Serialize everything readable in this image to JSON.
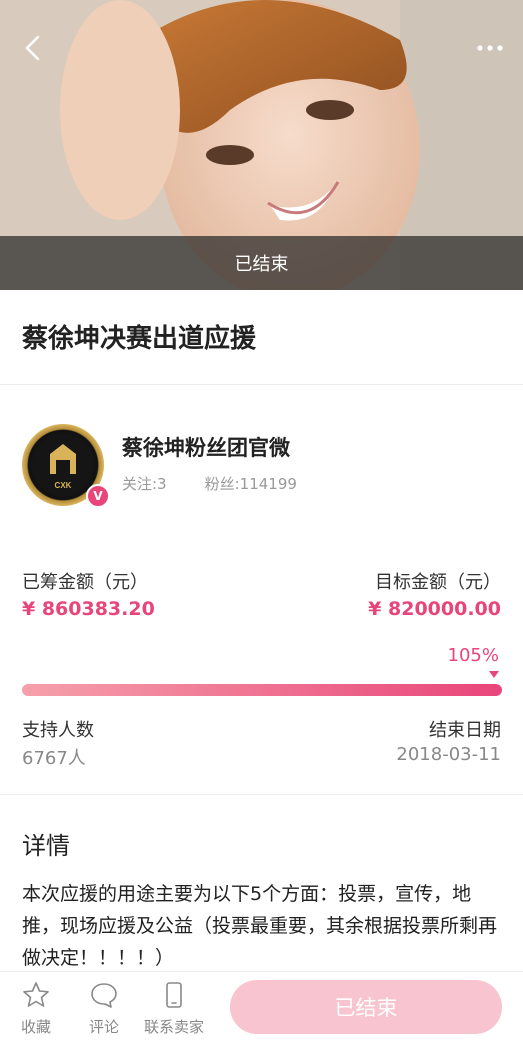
{
  "hero": {
    "status_label": "已结束"
  },
  "project": {
    "title": "蔡徐坤决赛出道应援"
  },
  "organizer": {
    "name": "蔡徐坤粉丝团官微",
    "follow_label": "关注:3",
    "fans_label": "粉丝:114199",
    "verified_badge": "V",
    "logo_text": "KUN'S FAN CLUB"
  },
  "funding": {
    "raised_label": "已筹金额（元）",
    "raised_value": "¥ 860383.20",
    "target_label": "目标金额（元）",
    "target_value": "¥ 820000.00",
    "percent_label": "105%",
    "progress_fraction": 1.0
  },
  "stats": {
    "supporters_label": "支持人数",
    "supporters_value": "6767人",
    "end_date_label": "结束日期",
    "end_date_value": "2018-03-11"
  },
  "detail": {
    "heading": "详情",
    "body": "本次应援的用途主要为以下5个方面：投票，宣传，地推，现场应援及公益（投票最重要，其余根据投票所剩再做决定！！！！）"
  },
  "tabbar": {
    "items": [
      {
        "label": "收藏",
        "icon": "star-icon"
      },
      {
        "label": "评论",
        "icon": "chat-bubble-icon"
      },
      {
        "label": "联系卖家",
        "icon": "phone-icon"
      }
    ],
    "action_label": "已结束"
  },
  "colors": {
    "accent": "#e8457a",
    "accent_light": "#f7c4cf",
    "muted": "#999999"
  }
}
